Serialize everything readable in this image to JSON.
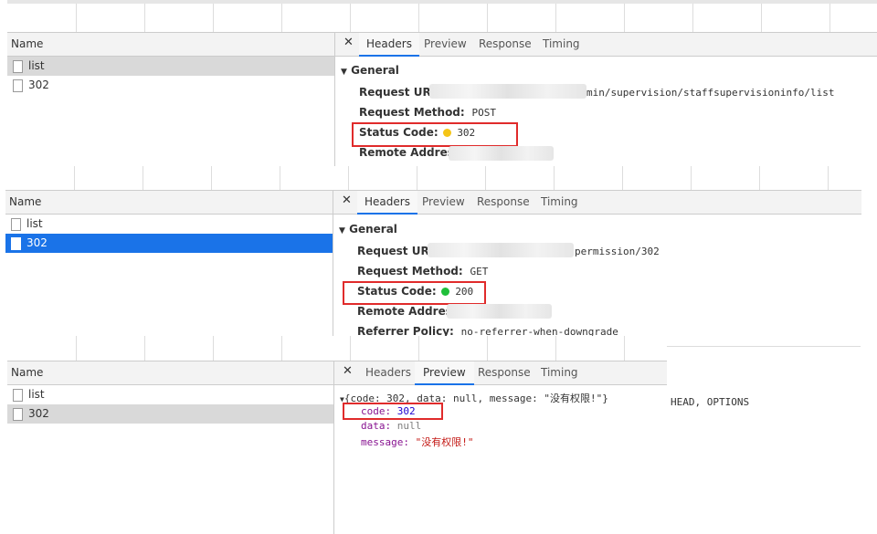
{
  "panes": [
    {
      "name_header": "Name",
      "requests": [
        "list",
        "302"
      ],
      "tabs": [
        "Headers",
        "Preview",
        "Response",
        "Timing"
      ],
      "section": "General",
      "request_url_label": "Request URL:",
      "request_url_value": "min/supervision/staffsupervisioninfo/list",
      "method_label": "Request Method:",
      "method_value": "POST",
      "status_label": "Status Code:",
      "status_value": "302",
      "status_color": "#f5c518",
      "remote_label": "Remote Address:"
    },
    {
      "name_header": "Name",
      "requests": [
        "list",
        "302"
      ],
      "tabs": [
        "Headers",
        "Preview",
        "Response",
        "Timing"
      ],
      "section": "General",
      "request_url_label": "Request URL:",
      "request_url_value": "permission/302",
      "method_label": "Request Method:",
      "method_value": "GET",
      "status_label": "Status Code:",
      "status_value": "200",
      "status_color": "#1fbf3a",
      "remote_label": "Remote Address:",
      "referrer_label": "Referrer Policy:",
      "referrer_value": "no-referrer-when-downgrade"
    },
    {
      "name_header": "Name",
      "requests": [
        "list",
        "302"
      ],
      "tabs": [
        "Headers",
        "Preview",
        "Response",
        "Timing"
      ],
      "preview_summary": "{code: 302, data: null, message: \"没有权限!\"}",
      "code_key": "code:",
      "code_value": "302",
      "data_key": "data:",
      "data_value": "null",
      "message_key": "message:",
      "message_value": "\"没有权限!\"",
      "background_text": "HEAD, OPTIONS"
    }
  ],
  "icons": {
    "close": "close-icon",
    "triangle": "triangle-down-icon",
    "file": "file-icon",
    "status_dot": "status-dot-icon"
  },
  "colors": {
    "selected_blue": "#1a73e8",
    "selected_grey": "#d9d9d9",
    "highlight_red": "#e02b2b",
    "json_key": "#881391",
    "json_number": "#1c00cf",
    "json_string": "#c41a16"
  }
}
